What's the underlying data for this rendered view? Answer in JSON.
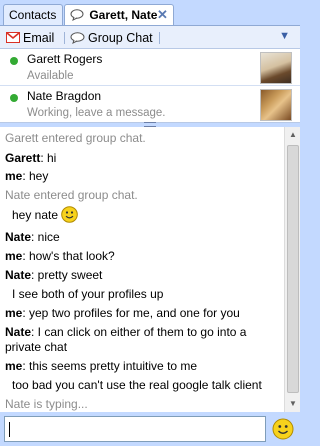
{
  "tabs": [
    {
      "label": "Contacts",
      "active": false
    },
    {
      "label": "Garett, Nate",
      "active": true
    }
  ],
  "toolbar": {
    "email_label": "Email",
    "group_chat_label": "Group Chat"
  },
  "participants": [
    {
      "name": "Garett Rogers",
      "status": "Available"
    },
    {
      "name": "Nate Bragdon",
      "status": "Working, leave a message."
    }
  ],
  "transcript": [
    {
      "type": "sys",
      "text": "Garett entered group chat."
    },
    {
      "type": "msg",
      "who": "Garett",
      "text": ": hi"
    },
    {
      "type": "msg",
      "who": "me",
      "text": ": hey"
    },
    {
      "type": "sys",
      "text": "Nate entered group chat."
    },
    {
      "type": "cont",
      "text": "hey nate"
    },
    {
      "type": "msg",
      "who": "Nate",
      "text": ": nice"
    },
    {
      "type": "msg",
      "who": "me",
      "text": ": how's that look?"
    },
    {
      "type": "msg",
      "who": "Nate",
      "text": ": pretty sweet"
    },
    {
      "type": "cont",
      "text": "I see both of your profiles up"
    },
    {
      "type": "msg",
      "who": "me",
      "text": ": yep two profiles for me, and one for you"
    },
    {
      "type": "msg",
      "who": "Nate",
      "text": ": I can click on either of them to go into a"
    },
    {
      "type": "plain",
      "text": "private chat"
    },
    {
      "type": "msg",
      "who": "me",
      "text": ": this seems pretty intuitive to me"
    },
    {
      "type": "cont",
      "text": "too bad you can't use the real google talk client"
    },
    {
      "type": "sys",
      "text": "Nate is typing..."
    }
  ],
  "colors": {
    "frame": "#c3d9ff",
    "online": "#33aa33",
    "system_text": "#8c8c8c",
    "gmail_red": "#d93025"
  },
  "icons": {
    "email": "gmail-m-icon",
    "group_chat": "chat-bubble-icon",
    "close": "close-icon",
    "menu": "triangle-down-icon",
    "presence": "green-dot-icon",
    "emoticon": "smiley-icon"
  }
}
